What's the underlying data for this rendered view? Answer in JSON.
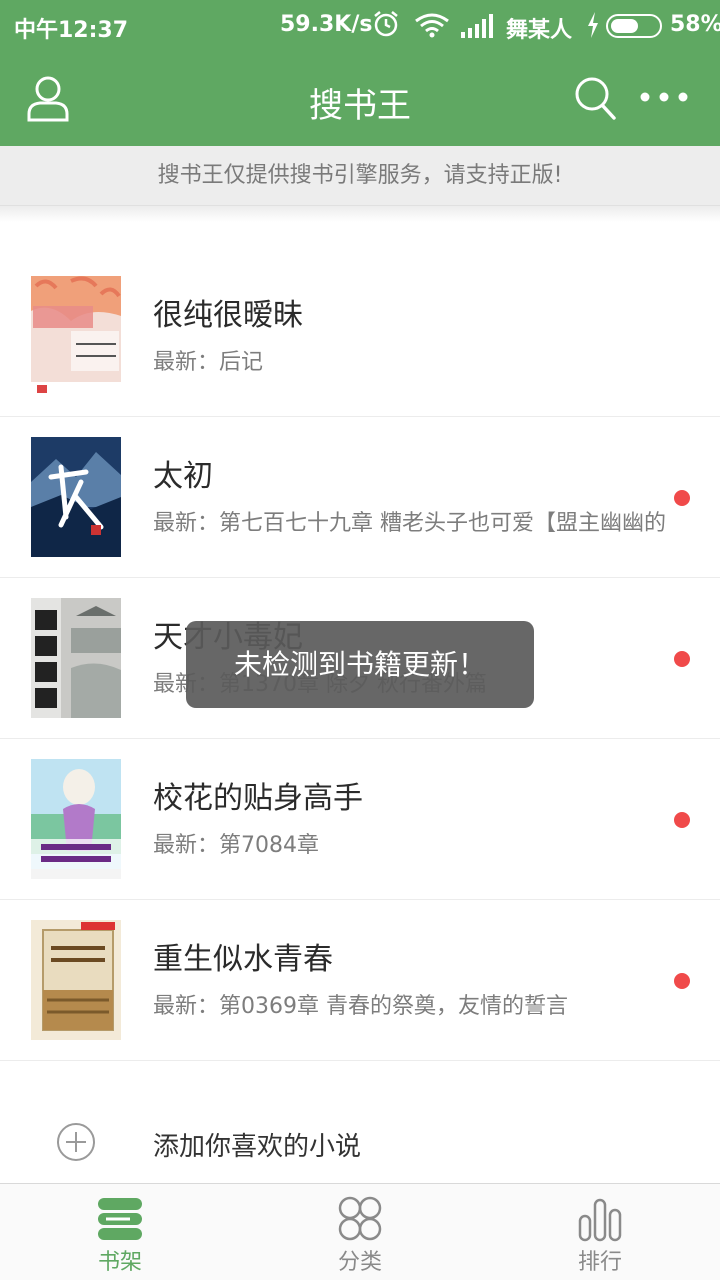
{
  "status_bar": {
    "time": "中午12:37",
    "speed": "59.3K/s",
    "carrier": "舞某人",
    "battery_percent": "58%",
    "battery_level": 0.58
  },
  "app_bar": {
    "title": "搜书王"
  },
  "notice": "搜书王仅提供搜书引擎服务，请支持正版!",
  "books": [
    {
      "title": "很纯很暧昧",
      "latest": "最新：后记",
      "has_update_dot": false
    },
    {
      "title": "太初",
      "latest": "最新：第七百七十九章 糟老头子也可爱【盟主幽幽的",
      "has_update_dot": true
    },
    {
      "title": "天才小毒妃",
      "latest": "最新：第1370章 除夕 秋行番外篇",
      "has_update_dot": true
    },
    {
      "title": "校花的贴身高手",
      "latest": "最新：第7084章",
      "has_update_dot": true
    },
    {
      "title": "重生似水青春",
      "latest": "最新：第0369章 青春的祭奠，友情的誓言",
      "has_update_dot": true
    }
  ],
  "add_novel_label": "添加你喜欢的小说",
  "toast": "未检测到书籍更新！",
  "bottom_nav": [
    {
      "label": "书架",
      "active": true
    },
    {
      "label": "分类",
      "active": false
    },
    {
      "label": "排行",
      "active": false
    }
  ],
  "colors": {
    "primary_green": "#5fa862",
    "update_dot": "#f04a4a"
  }
}
